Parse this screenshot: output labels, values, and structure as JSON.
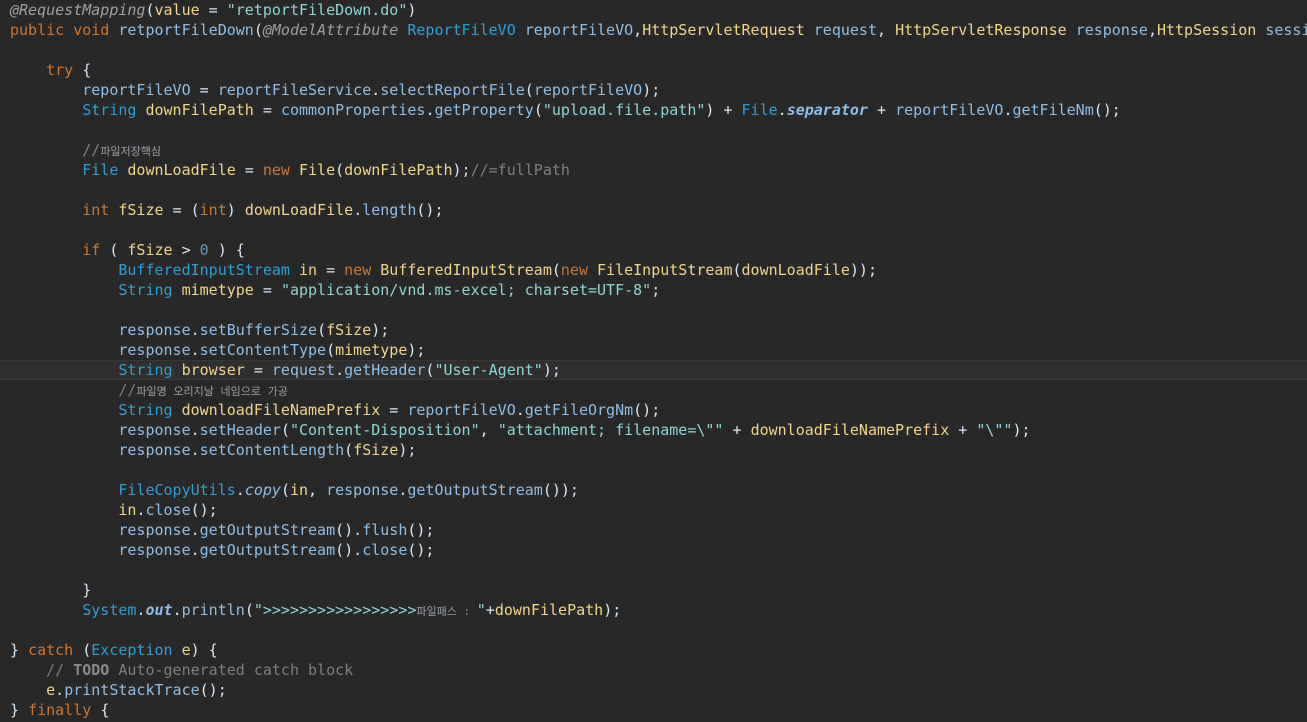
{
  "editor": {
    "lines": [
      {
        "tokens": [
          {
            "t": "@RequestMapping",
            "c": "ann"
          },
          {
            "t": "(",
            "c": "plain"
          },
          {
            "t": "value",
            "c": "var"
          },
          {
            "t": " = ",
            "c": "plain"
          },
          {
            "t": "\"retportFileDown.do\"",
            "c": "str"
          },
          {
            "t": ")",
            "c": "plain"
          }
        ]
      },
      {
        "tokens": [
          {
            "t": "public void ",
            "c": "kw"
          },
          {
            "t": "retportFileDown",
            "c": "fld"
          },
          {
            "t": "(",
            "c": "plain"
          },
          {
            "t": "@ModelAttribute ",
            "c": "ann"
          },
          {
            "t": "ReportFileVO ",
            "c": "type"
          },
          {
            "t": "reportFileVO",
            "c": "fld"
          },
          {
            "t": ",",
            "c": "plain"
          },
          {
            "t": "HttpServletRequest ",
            "c": "var"
          },
          {
            "t": "request",
            "c": "fld"
          },
          {
            "t": ", ",
            "c": "plain"
          },
          {
            "t": "HttpServletResponse ",
            "c": "var"
          },
          {
            "t": "response",
            "c": "fld"
          },
          {
            "t": ",",
            "c": "plain"
          },
          {
            "t": "HttpSession ",
            "c": "var"
          },
          {
            "t": "session",
            "c": "fld"
          },
          {
            "t": ") {",
            "c": "plain"
          }
        ]
      },
      {
        "tokens": []
      },
      {
        "tokens": [
          {
            "t": "    try ",
            "c": "kw"
          },
          {
            "t": "{",
            "c": "plain"
          }
        ]
      },
      {
        "tokens": [
          {
            "t": "        reportFileVO",
            "c": "fld"
          },
          {
            "t": " = ",
            "c": "plain"
          },
          {
            "t": "reportFileService",
            "c": "fld"
          },
          {
            "t": ".",
            "c": "plain"
          },
          {
            "t": "selectReportFile",
            "c": "fld"
          },
          {
            "t": "(",
            "c": "plain"
          },
          {
            "t": "reportFileVO",
            "c": "fld"
          },
          {
            "t": ");",
            "c": "plain"
          }
        ]
      },
      {
        "tokens": [
          {
            "t": "        String ",
            "c": "type"
          },
          {
            "t": "downFilePath",
            "c": "var"
          },
          {
            "t": " = ",
            "c": "plain"
          },
          {
            "t": "commonProperties",
            "c": "fld"
          },
          {
            "t": ".",
            "c": "plain"
          },
          {
            "t": "getProperty",
            "c": "fld"
          },
          {
            "t": "(",
            "c": "plain"
          },
          {
            "t": "\"upload.file.path\"",
            "c": "str"
          },
          {
            "t": ") + ",
            "c": "plain"
          },
          {
            "t": "File",
            "c": "type"
          },
          {
            "t": ".",
            "c": "plain"
          },
          {
            "t": "separator",
            "c": "static"
          },
          {
            "t": " + ",
            "c": "plain"
          },
          {
            "t": "reportFileVO",
            "c": "fld"
          },
          {
            "t": ".",
            "c": "plain"
          },
          {
            "t": "getFileNm",
            "c": "fld"
          },
          {
            "t": "();",
            "c": "plain"
          }
        ]
      },
      {
        "tokens": []
      },
      {
        "tokens": [
          {
            "t": "        //",
            "c": "cmt"
          },
          {
            "t": "파일저장핵심",
            "c": "kcmt"
          }
        ]
      },
      {
        "tokens": [
          {
            "t": "        File ",
            "c": "type"
          },
          {
            "t": "downLoadFile",
            "c": "var"
          },
          {
            "t": " = ",
            "c": "plain"
          },
          {
            "t": "new ",
            "c": "kw"
          },
          {
            "t": "File",
            "c": "var"
          },
          {
            "t": "(",
            "c": "plain"
          },
          {
            "t": "downFilePath",
            "c": "var"
          },
          {
            "t": ");",
            "c": "plain"
          },
          {
            "t": "//=fullPath",
            "c": "cmt"
          }
        ]
      },
      {
        "tokens": []
      },
      {
        "tokens": [
          {
            "t": "        int ",
            "c": "kw"
          },
          {
            "t": "fSize",
            "c": "var"
          },
          {
            "t": " = (",
            "c": "plain"
          },
          {
            "t": "int",
            "c": "kw"
          },
          {
            "t": ") ",
            "c": "plain"
          },
          {
            "t": "downLoadFile",
            "c": "var"
          },
          {
            "t": ".",
            "c": "plain"
          },
          {
            "t": "length",
            "c": "fld"
          },
          {
            "t": "();",
            "c": "plain"
          }
        ]
      },
      {
        "tokens": []
      },
      {
        "tokens": [
          {
            "t": "        if ",
            "c": "kw"
          },
          {
            "t": "( ",
            "c": "plain"
          },
          {
            "t": "fSize",
            "c": "var"
          },
          {
            "t": " > ",
            "c": "plain"
          },
          {
            "t": "0",
            "c": "num"
          },
          {
            "t": " ) {",
            "c": "plain"
          }
        ]
      },
      {
        "tokens": [
          {
            "t": "            BufferedInputStream ",
            "c": "type"
          },
          {
            "t": "in",
            "c": "var"
          },
          {
            "t": " = ",
            "c": "plain"
          },
          {
            "t": "new ",
            "c": "kw"
          },
          {
            "t": "BufferedInputStream",
            "c": "var"
          },
          {
            "t": "(",
            "c": "plain"
          },
          {
            "t": "new ",
            "c": "kw"
          },
          {
            "t": "FileInputStream",
            "c": "var"
          },
          {
            "t": "(",
            "c": "plain"
          },
          {
            "t": "downLoadFile",
            "c": "var"
          },
          {
            "t": "));",
            "c": "plain"
          }
        ]
      },
      {
        "tokens": [
          {
            "t": "            String ",
            "c": "type"
          },
          {
            "t": "mimetype",
            "c": "var"
          },
          {
            "t": " = ",
            "c": "plain"
          },
          {
            "t": "\"application/vnd.ms-excel; charset=UTF-8\"",
            "c": "str"
          },
          {
            "t": ";",
            "c": "plain"
          }
        ]
      },
      {
        "tokens": []
      },
      {
        "tokens": [
          {
            "t": "            response",
            "c": "fld"
          },
          {
            "t": ".",
            "c": "plain"
          },
          {
            "t": "setBufferSize",
            "c": "fld"
          },
          {
            "t": "(",
            "c": "plain"
          },
          {
            "t": "fSize",
            "c": "var"
          },
          {
            "t": ");",
            "c": "plain"
          }
        ]
      },
      {
        "tokens": [
          {
            "t": "            response",
            "c": "fld"
          },
          {
            "t": ".",
            "c": "plain"
          },
          {
            "t": "setContentType",
            "c": "fld"
          },
          {
            "t": "(",
            "c": "plain"
          },
          {
            "t": "mimetype",
            "c": "var"
          },
          {
            "t": ");",
            "c": "plain"
          }
        ]
      },
      {
        "current": true,
        "tokens": [
          {
            "t": "            String ",
            "c": "type"
          },
          {
            "t": "browser",
            "c": "var warn"
          },
          {
            "t": " = ",
            "c": "plain"
          },
          {
            "t": "request",
            "c": "fld"
          },
          {
            "t": ".",
            "c": "plain"
          },
          {
            "t": "getHeader",
            "c": "fld"
          },
          {
            "t": "(",
            "c": "plain"
          },
          {
            "t": "\"User-Agent\"",
            "c": "str"
          },
          {
            "t": ");",
            "c": "plain"
          }
        ]
      },
      {
        "tokens": [
          {
            "t": "            //",
            "c": "cmt"
          },
          {
            "t": "파일명 오리지날 네임으로 가공",
            "c": "kcmt"
          }
        ]
      },
      {
        "tokens": [
          {
            "t": "            String ",
            "c": "type"
          },
          {
            "t": "downloadFileNamePrefix",
            "c": "var"
          },
          {
            "t": " = ",
            "c": "plain"
          },
          {
            "t": "reportFileVO",
            "c": "fld"
          },
          {
            "t": ".",
            "c": "plain"
          },
          {
            "t": "getFileOrgNm",
            "c": "fld"
          },
          {
            "t": "();",
            "c": "plain"
          }
        ]
      },
      {
        "tokens": [
          {
            "t": "            response",
            "c": "fld"
          },
          {
            "t": ".",
            "c": "plain"
          },
          {
            "t": "setHeader",
            "c": "fld"
          },
          {
            "t": "(",
            "c": "plain"
          },
          {
            "t": "\"Content-Disposition\"",
            "c": "str"
          },
          {
            "t": ", ",
            "c": "plain"
          },
          {
            "t": "\"attachment; filename=\\\"\"",
            "c": "str"
          },
          {
            "t": " + ",
            "c": "plain"
          },
          {
            "t": "downloadFileNamePrefix",
            "c": "var"
          },
          {
            "t": " + ",
            "c": "plain"
          },
          {
            "t": "\"\\\"\"",
            "c": "str"
          },
          {
            "t": ");",
            "c": "plain"
          }
        ]
      },
      {
        "tokens": [
          {
            "t": "            response",
            "c": "fld"
          },
          {
            "t": ".",
            "c": "plain"
          },
          {
            "t": "setContentLength",
            "c": "fld"
          },
          {
            "t": "(",
            "c": "plain"
          },
          {
            "t": "fSize",
            "c": "var"
          },
          {
            "t": ");",
            "c": "plain"
          }
        ]
      },
      {
        "tokens": []
      },
      {
        "tokens": [
          {
            "t": "            FileCopyUtils",
            "c": "type"
          },
          {
            "t": ".",
            "c": "plain"
          },
          {
            "t": "copy",
            "c": "smethod"
          },
          {
            "t": "(",
            "c": "plain"
          },
          {
            "t": "in",
            "c": "var"
          },
          {
            "t": ", ",
            "c": "plain"
          },
          {
            "t": "response",
            "c": "fld"
          },
          {
            "t": ".",
            "c": "plain"
          },
          {
            "t": "getOutputStream",
            "c": "fld"
          },
          {
            "t": "());",
            "c": "plain"
          }
        ]
      },
      {
        "tokens": [
          {
            "t": "            in",
            "c": "var"
          },
          {
            "t": ".",
            "c": "plain"
          },
          {
            "t": "close",
            "c": "fld"
          },
          {
            "t": "();",
            "c": "plain"
          }
        ]
      },
      {
        "tokens": [
          {
            "t": "            response",
            "c": "fld"
          },
          {
            "t": ".",
            "c": "plain"
          },
          {
            "t": "getOutputStream",
            "c": "fld"
          },
          {
            "t": "().",
            "c": "plain"
          },
          {
            "t": "flush",
            "c": "fld"
          },
          {
            "t": "();",
            "c": "plain"
          }
        ]
      },
      {
        "tokens": [
          {
            "t": "            response",
            "c": "fld"
          },
          {
            "t": ".",
            "c": "plain"
          },
          {
            "t": "getOutputStream",
            "c": "fld"
          },
          {
            "t": "().",
            "c": "plain"
          },
          {
            "t": "close",
            "c": "fld"
          },
          {
            "t": "();",
            "c": "plain"
          }
        ]
      },
      {
        "tokens": []
      },
      {
        "tokens": [
          {
            "t": "        }",
            "c": "plain"
          }
        ]
      },
      {
        "tokens": [
          {
            "t": "        System",
            "c": "type"
          },
          {
            "t": ".",
            "c": "plain"
          },
          {
            "t": "out",
            "c": "static"
          },
          {
            "t": ".",
            "c": "plain"
          },
          {
            "t": "println",
            "c": "fld"
          },
          {
            "t": "(",
            "c": "plain"
          },
          {
            "t": "\">>>>>>>>>>>>>>>>>",
            "c": "str"
          },
          {
            "t": "파일패스 : ",
            "c": "kcmt"
          },
          {
            "t": "\"",
            "c": "str"
          },
          {
            "t": "+",
            "c": "plain"
          },
          {
            "t": "downFilePath",
            "c": "var"
          },
          {
            "t": ");",
            "c": "plain"
          }
        ]
      },
      {
        "tokens": []
      },
      {
        "tokens": [
          {
            "t": "} ",
            "c": "plain"
          },
          {
            "t": "catch ",
            "c": "kw"
          },
          {
            "t": "(",
            "c": "plain"
          },
          {
            "t": "Exception ",
            "c": "type"
          },
          {
            "t": "e",
            "c": "var"
          },
          {
            "t": ") {",
            "c": "plain"
          }
        ]
      },
      {
        "tokens": [
          {
            "t": "    // ",
            "c": "cmt"
          },
          {
            "t": "TODO",
            "c": "todo"
          },
          {
            "t": " Auto-generated catch block",
            "c": "cmt"
          }
        ]
      },
      {
        "tokens": [
          {
            "t": "    e",
            "c": "var"
          },
          {
            "t": ".",
            "c": "plain"
          },
          {
            "t": "printStackTrace",
            "c": "fld"
          },
          {
            "t": "();",
            "c": "plain"
          }
        ]
      },
      {
        "tokens": [
          {
            "t": "} ",
            "c": "plain"
          },
          {
            "t": "finally ",
            "c": "kw"
          },
          {
            "t": "{",
            "c": "plain"
          }
        ]
      }
    ]
  }
}
